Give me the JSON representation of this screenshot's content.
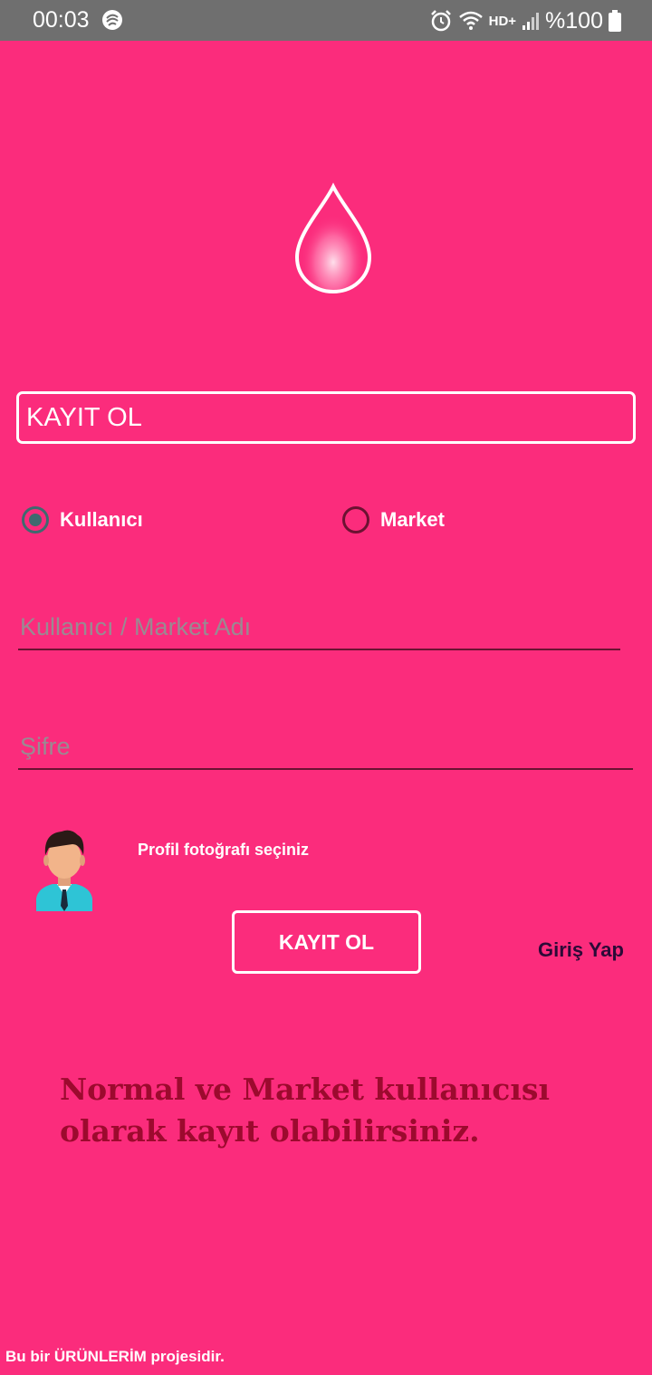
{
  "status_bar": {
    "time": "00:03",
    "network": "HD+",
    "battery": "%100",
    "icons": [
      "app-notification-icon",
      "alarm-icon",
      "wifi-icon",
      "signal-icon",
      "battery-icon"
    ]
  },
  "logo": {
    "icon": "water-drop-icon"
  },
  "header": {
    "title": "KAYIT OL"
  },
  "account_type": {
    "options": [
      {
        "label": "Kullanıcı",
        "checked": true
      },
      {
        "label": "Market",
        "checked": false
      }
    ]
  },
  "form": {
    "username_placeholder": "Kullanıcı / Market Adı",
    "password_placeholder": "Şifre",
    "photo_label": "Profil fotoğrafı seçiniz",
    "avatar_icon": "user-avatar-icon",
    "submit_label": "KAYIT OL",
    "login_link": "Giriş Yap"
  },
  "info_text": "Normal ve Market kullanıcısı olarak kayıt olabilirsiniz.",
  "footer_text": "Bu bir ÜRÜNLERİM projesidir.",
  "colors": {
    "background": "#fb2c7c",
    "status_bar": "#6f6f6f",
    "info_text": "#9c0a2e",
    "radio_checked": "#3f6a6f",
    "underline": "#6b1232"
  }
}
